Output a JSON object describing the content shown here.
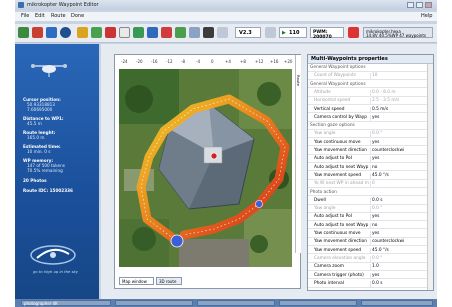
{
  "window": {
    "title": "mikrokopter Waypoint Editor",
    "help": "Help"
  },
  "menu": [
    "File",
    "Edit",
    "Route",
    "Done"
  ],
  "toolbar": {
    "version": "V2.3",
    "speed": "110",
    "pwm": "PWM: 200070",
    "info_line1": "mikrokopter.hexa",
    "info_line2": "14.8V 40.5%WP 47 waypoints"
  },
  "left_panel": [
    {
      "label": "Cursor position:",
      "value": "50.93318813"
    },
    {
      "label": "",
      "value": "7.60695000"
    },
    {
      "label": "Distance to WP1:",
      "value": "45.5 m"
    },
    {
      "label": "Route lenght:",
      "value": "165.0 m"
    },
    {
      "label": "Estimated time:",
      "value": "10 min. 0 s"
    },
    {
      "label": "WP memory:",
      "value": "147 of 500 tokens"
    },
    {
      "label": "",
      "value": "70.5% remaining"
    },
    {
      "label": "20 Photos",
      "value": ""
    },
    {
      "label": "Route IDC: 15002336",
      "value": ""
    }
  ],
  "brand": "go to high up in the sky",
  "map": {
    "ruler_top": [
      "-24",
      "-20",
      "-16",
      "-12",
      "-8",
      "-4",
      "0",
      "+4",
      "+8",
      "+12",
      "+16",
      "+20"
    ],
    "tabs": [
      "Map window",
      "3D route"
    ],
    "side_tab": "Route"
  },
  "properties": {
    "title": "Multi-Waypoints properties",
    "rows": [
      {
        "k": "General Waypoint options",
        "v": "",
        "type": "section"
      },
      {
        "k": "Count of Waypoints",
        "v": "10",
        "type": "dim"
      },
      {
        "k": "General Waypoint options",
        "v": "",
        "type": "section"
      },
      {
        "k": "Altitude",
        "v": "0.0 - 8.0 m",
        "type": "dim"
      },
      {
        "k": "Horizontal speed",
        "v": "2.5 - 3.5 m/s",
        "type": "dim"
      },
      {
        "k": "Vertical speed",
        "v": "0.5 m/s",
        "type": "normal"
      },
      {
        "k": "Camera control by Wayp",
        "v": "yes",
        "type": "normal"
      },
      {
        "k": "Section gaze options",
        "v": "",
        "type": "section"
      },
      {
        "k": "Yaw angle",
        "v": "0.0 °",
        "type": "dim"
      },
      {
        "k": "Yaw continuous move",
        "v": "yes",
        "type": "normal"
      },
      {
        "k": "Yaw movement direction",
        "v": "counterclockwi",
        "type": "normal"
      },
      {
        "k": "Auto adjust to PoI",
        "v": "yes",
        "type": "normal"
      },
      {
        "k": "Auto adjust to next Wayp",
        "v": "no",
        "type": "normal"
      },
      {
        "k": "Yaw movement speed",
        "v": "45.0 °/s",
        "type": "normal"
      },
      {
        "k": "Yo W next WP in ahead m",
        "v": "0",
        "type": "dim"
      },
      {
        "k": "Photo action",
        "v": "",
        "type": "section"
      },
      {
        "k": "Dwell",
        "v": "0.0 s",
        "type": "normal"
      },
      {
        "k": "Yaw angle",
        "v": "0.0 °",
        "type": "dim"
      },
      {
        "k": "Auto adjust to PoI",
        "v": "yes",
        "type": "normal"
      },
      {
        "k": "Auto adjust to next Wayp",
        "v": "no",
        "type": "normal"
      },
      {
        "k": "Yaw continuous move",
        "v": "yes",
        "type": "normal"
      },
      {
        "k": "Yaw movement direction",
        "v": "counterclockwi",
        "type": "normal"
      },
      {
        "k": "Yaw movement speed",
        "v": "45.0 °/s",
        "type": "normal"
      },
      {
        "k": "Camera elevation angle",
        "v": "0.0 °",
        "type": "dim"
      },
      {
        "k": "Camera zoom",
        "v": "1.0",
        "type": "normal"
      },
      {
        "k": "Camera trigger (photo)",
        "v": "yes",
        "type": "normal"
      },
      {
        "k": "Photo interval",
        "v": "0.0 s",
        "type": "normal"
      }
    ]
  },
  "status_bar": [
    "photographer 4K",
    "",
    "",
    "",
    ""
  ]
}
